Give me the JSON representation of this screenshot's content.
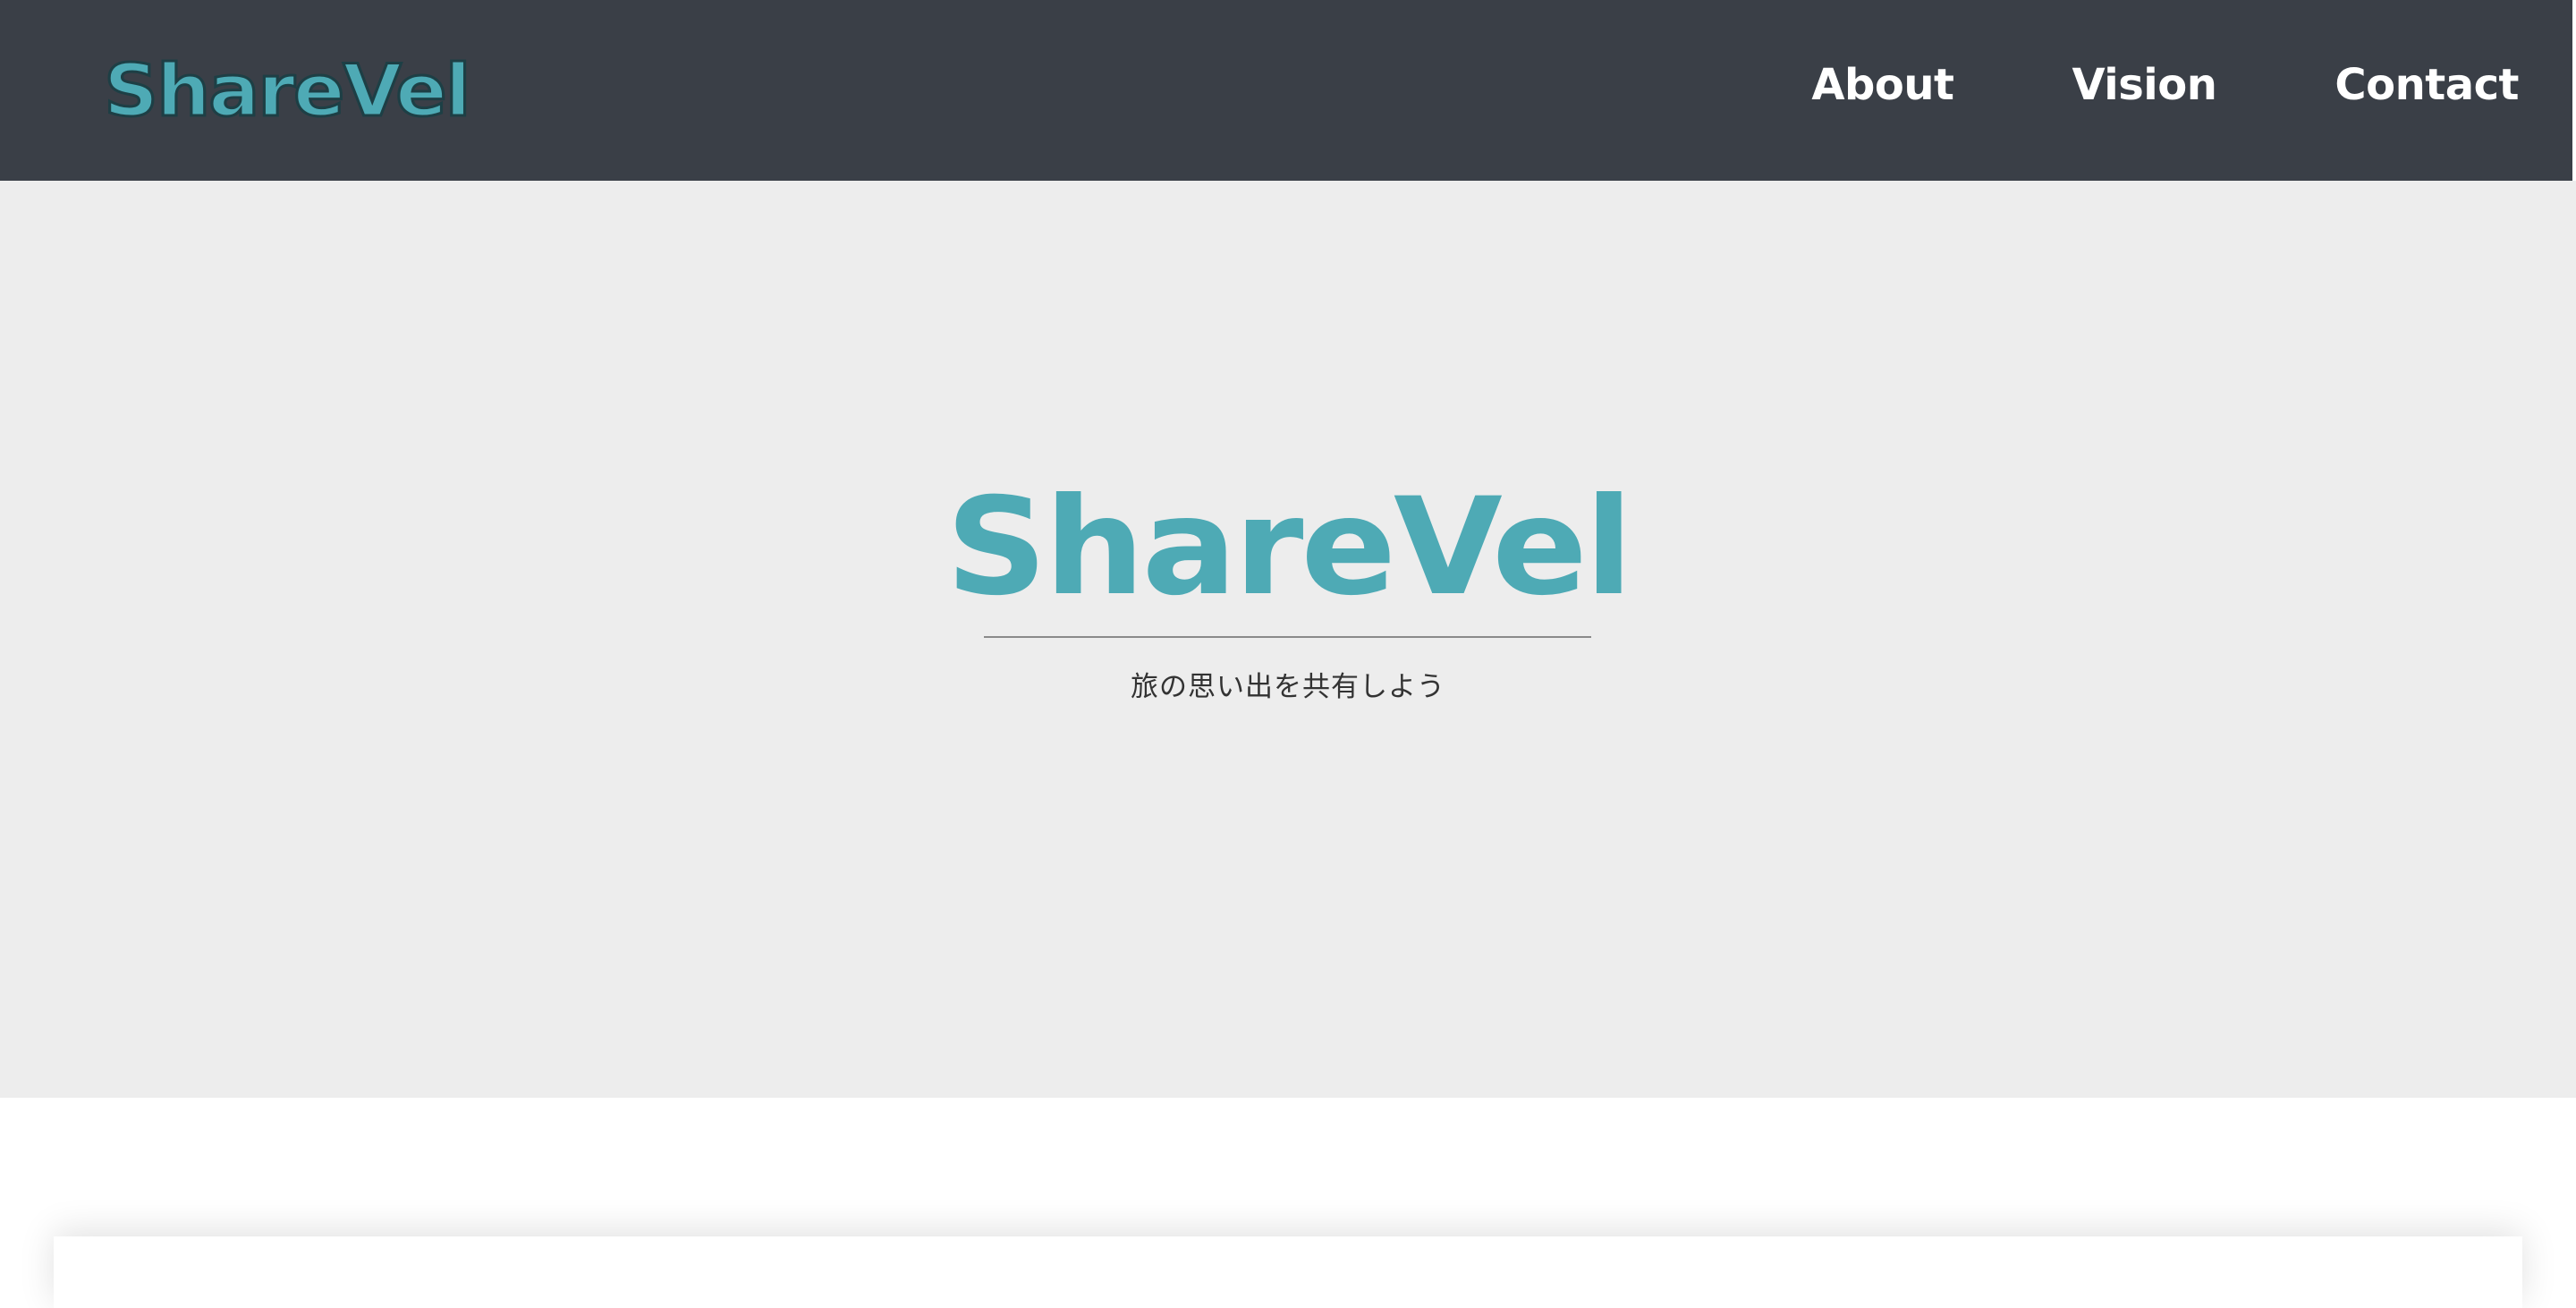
{
  "header": {
    "logo": "ShareVel",
    "nav": [
      {
        "label": "About"
      },
      {
        "label": "Vision"
      },
      {
        "label": "Contact"
      }
    ]
  },
  "hero": {
    "title": "ShareVel",
    "tagline": "旅の思い出を共有しよう"
  },
  "colors": {
    "header_bg": "#3a3f47",
    "brand": "#4eaab5",
    "hero_bg": "#ededed"
  }
}
